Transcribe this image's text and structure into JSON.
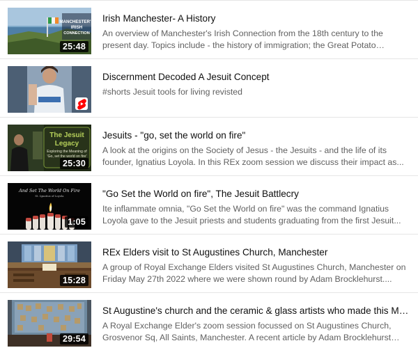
{
  "videos": [
    {
      "title": "Irish Manchester- A History",
      "description": "An overview of Manchester's Irish Connection from the 18th century to the present day. Topics include - the history of immigration; the Great Potato Famine...",
      "duration": "25:48",
      "thumbnail_text": "MANCHESTER'S IRISH CONNECTION"
    },
    {
      "title": "Discernment Decoded A Jesuit Concept",
      "description": "#shorts Jesuit tools for living revisted",
      "badge_icon": "youtube-shorts-icon",
      "badge_color": "#ff0000"
    },
    {
      "title": "Jesuits - \"go, set the world on fire\"",
      "description": "A look at the origins on the Society of Jesus - the Jesuits - and the life of its founder, Ignatius Loyola. In this REx zoom session we discuss their impact as...",
      "duration": "25:30",
      "thumbnail_text_title": "The Jesuit Legacy",
      "thumbnail_text_sub": "Exploring the Meaning of 'Go, set the world on fire'"
    },
    {
      "title": "\"Go Set the World on fire\", The Jesuit Battlecry",
      "description": "Ite inflammate omnia, \"Go Set the World on fire\" was the command Ignatius Loyola gave to the Jesuit priests and students graduating from the first Jesuit...",
      "duration": "1:05",
      "thumbnail_text": "And Set The World On Fire",
      "thumbnail_text_sub": "St. Ignatius of Loyola"
    },
    {
      "title": "REx Elders visit to St Augustines Church, Manchester",
      "description": "A group of Royal Exchange Elders visited St Augustines Church, Manchester on Friday May 27th 2022 where we were shown round by Adam Brocklehurst....",
      "duration": "15:28"
    },
    {
      "title": "St Augustine's church and the ceramic & glass artists who made this Manc...",
      "description": "A Royal Exchange Elder's zoom session focussed on St Augustines Church, Grosvenor Sq, All Saints, Manchester. A recent article by Adam Brocklehurst for...",
      "duration": "29:54"
    }
  ],
  "colors": {
    "title_text": "#0f0f0f",
    "description_text": "#606060",
    "divider": "#e5e5e5",
    "duration_badge_bg": "#000000"
  }
}
